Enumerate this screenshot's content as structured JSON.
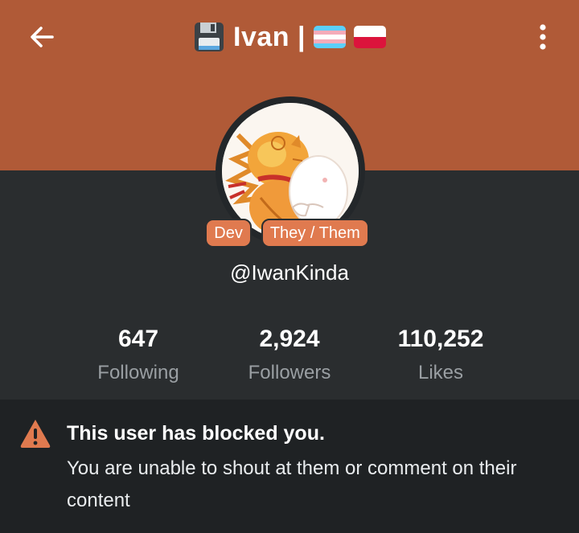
{
  "header": {
    "emoji_icon": "floppy-disk-icon",
    "title": "Ivan |",
    "flags": [
      "transgender-flag",
      "poland-flag"
    ],
    "bg_color": "#b05a37"
  },
  "profile": {
    "badges": [
      "Dev",
      "They / Them"
    ],
    "handle": "@IwanKinda",
    "badge_color": "#e07a4f"
  },
  "stats": [
    {
      "value": "647",
      "label": "Following"
    },
    {
      "value": "2,924",
      "label": "Followers"
    },
    {
      "value": "110,252",
      "label": "Likes"
    }
  ],
  "alert": {
    "icon": "warning-icon",
    "title": "This user has blocked you.",
    "body": "You are unable to shout at them or comment on their content",
    "accent": "#e07a4f"
  }
}
